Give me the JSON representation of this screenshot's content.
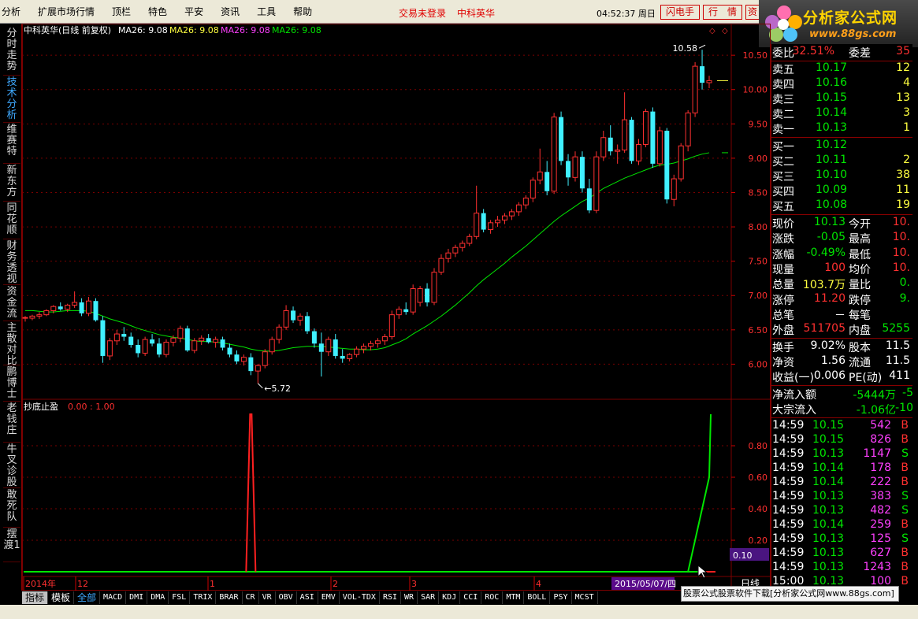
{
  "menu": {
    "items": [
      "分析",
      "扩展市场行情",
      "顶栏",
      "特色",
      "平安",
      "资讯",
      "工具",
      "帮助"
    ],
    "trade_status": "交易未登录",
    "stock_name": "中科英华",
    "clock": "04:52:37 周日",
    "btn_flash": "闪电手",
    "btn_quote": "行　情",
    "btn_info": "资"
  },
  "logo": {
    "title": "分析家公式网",
    "url": "www.88gs.com"
  },
  "left_tabs": [
    "分时走势",
    "技术分析",
    "维赛特",
    "新东方",
    "同花顺",
    "财务透视",
    "资金流",
    "主散对比",
    "鹏博士",
    "老钱庄",
    "牛叉诊股",
    "敢死队",
    "摆渡1"
  ],
  "chart": {
    "header_title": "中科英华(日线 前复权)",
    "ma_items": [
      {
        "label": "MA26: 9.08",
        "color": "#ffffff"
      },
      {
        "label": "MA26: 9.08",
        "color": "#ffff40"
      },
      {
        "label": "MA26: 9.08",
        "color": "#ff40ff"
      },
      {
        "label": "MA26: 9.08",
        "color": "#00e600"
      }
    ],
    "high_label": "10.58",
    "low_label": "5.72",
    "price_ticks": [
      "10.50",
      "10.00",
      "9.50",
      "9.00",
      "8.50",
      "8.00",
      "7.50",
      "7.00",
      "6.50",
      "6.00"
    ],
    "indicator_title": "抄底止盈",
    "indicator_values": "0.00 : 1.00",
    "indicator_ticks": [
      "0.80",
      "0.60",
      "0.40",
      "0.20"
    ],
    "indicator_current": "0.10",
    "date_labels": [
      {
        "text": "2014年",
        "color": "#ff3030",
        "month": 0
      },
      {
        "text": "12",
        "color": "#ff3030",
        "month": 1
      },
      {
        "text": "1",
        "color": "#ff3030",
        "month": 2
      },
      {
        "text": "2",
        "color": "#ff3030",
        "month": 3
      },
      {
        "text": "3",
        "color": "#ff3030",
        "month": 4
      },
      {
        "text": "4",
        "color": "#ff3030",
        "month": 5
      }
    ],
    "date_cursor": "2015/05/07/四",
    "period": "日线",
    "colors": {
      "up": "#ff3030",
      "down": "#40f0ff",
      "ma": "#00e600",
      "grid": "#7a0000",
      "signal_up": "#ff2020",
      "signal_down": "#00e600"
    }
  },
  "chart_data": {
    "type": "candlestick",
    "title": "中科英华(日线 前复权)",
    "ylim": [
      5.5,
      10.8
    ],
    "high": 10.58,
    "low": 5.72,
    "ma26_last": 9.08,
    "candles": [
      [
        6.68,
        6.7,
        6.62,
        6.68
      ],
      [
        6.67,
        6.72,
        6.64,
        6.7
      ],
      [
        6.7,
        6.76,
        6.66,
        6.72
      ],
      [
        6.72,
        6.8,
        6.7,
        6.78
      ],
      [
        6.78,
        6.86,
        6.74,
        6.84
      ],
      [
        6.84,
        6.9,
        6.78,
        6.8
      ],
      [
        6.8,
        6.88,
        6.76,
        6.86
      ],
      [
        6.86,
        7.06,
        6.82,
        6.9
      ],
      [
        6.9,
        6.96,
        6.7,
        6.74
      ],
      [
        6.74,
        6.98,
        6.7,
        6.92
      ],
      [
        6.92,
        6.96,
        6.62,
        6.64
      ],
      [
        6.64,
        6.7,
        6.02,
        6.12
      ],
      [
        6.12,
        6.38,
        6.06,
        6.34
      ],
      [
        6.34,
        6.5,
        6.28,
        6.44
      ],
      [
        6.44,
        6.54,
        6.34,
        6.4
      ],
      [
        6.4,
        6.46,
        6.24,
        6.28
      ],
      [
        6.28,
        6.36,
        6.1,
        6.16
      ],
      [
        6.16,
        6.4,
        6.12,
        6.36
      ],
      [
        6.36,
        6.44,
        6.26,
        6.3
      ],
      [
        6.3,
        6.38,
        6.1,
        6.14
      ],
      [
        6.14,
        6.36,
        6.1,
        6.32
      ],
      [
        6.32,
        6.42,
        6.26,
        6.38
      ],
      [
        6.38,
        6.56,
        6.32,
        6.52
      ],
      [
        6.52,
        6.56,
        6.18,
        6.2
      ],
      [
        6.2,
        6.38,
        6.16,
        6.34
      ],
      [
        6.34,
        6.42,
        6.28,
        6.38
      ],
      [
        6.38,
        6.44,
        6.3,
        6.32
      ],
      [
        6.32,
        6.4,
        6.24,
        6.36
      ],
      [
        6.36,
        6.4,
        6.2,
        6.24
      ],
      [
        6.24,
        6.3,
        6.1,
        6.14
      ],
      [
        6.14,
        6.2,
        6.0,
        6.04
      ],
      [
        6.04,
        6.14,
        5.98,
        6.1
      ],
      [
        6.1,
        6.16,
        5.84,
        5.9
      ],
      [
        5.9,
        6.0,
        5.72,
        5.98
      ],
      [
        5.98,
        6.22,
        5.94,
        6.18
      ],
      [
        6.18,
        6.4,
        6.14,
        6.36
      ],
      [
        6.36,
        6.58,
        6.3,
        6.54
      ],
      [
        6.54,
        6.86,
        6.5,
        6.78
      ],
      [
        6.78,
        6.84,
        6.6,
        6.64
      ],
      [
        6.64,
        6.74,
        6.56,
        6.7
      ],
      [
        6.7,
        6.76,
        6.44,
        6.48
      ],
      [
        6.48,
        6.52,
        6.24,
        6.3
      ],
      [
        6.3,
        6.46,
        5.82,
        6.18
      ],
      [
        6.18,
        6.4,
        6.12,
        6.36
      ],
      [
        6.36,
        6.44,
        6.08,
        6.12
      ],
      [
        6.12,
        6.22,
        6.02,
        6.08
      ],
      [
        6.08,
        6.16,
        6.04,
        6.14
      ],
      [
        6.14,
        6.26,
        6.1,
        6.22
      ],
      [
        6.22,
        6.3,
        6.16,
        6.26
      ],
      [
        6.26,
        6.34,
        6.2,
        6.3
      ],
      [
        6.3,
        6.38,
        6.24,
        6.34
      ],
      [
        6.34,
        6.44,
        6.28,
        6.4
      ],
      [
        6.4,
        6.78,
        6.36,
        6.72
      ],
      [
        6.72,
        6.84,
        6.66,
        6.8
      ],
      [
        6.8,
        6.9,
        6.72,
        6.76
      ],
      [
        6.76,
        7.16,
        6.72,
        7.1
      ],
      [
        6.9,
        7.14,
        6.84,
        7.1
      ],
      [
        7.1,
        7.18,
        6.84,
        6.9
      ],
      [
        6.9,
        7.4,
        6.86,
        7.34
      ],
      [
        7.34,
        7.6,
        7.3,
        7.54
      ],
      [
        7.54,
        7.68,
        7.48,
        7.62
      ],
      [
        7.62,
        7.74,
        7.56,
        7.7
      ],
      [
        7.7,
        7.8,
        7.64,
        7.76
      ],
      [
        7.76,
        7.9,
        7.72,
        7.86
      ],
      [
        7.86,
        8.6,
        7.82,
        8.2
      ],
      [
        8.2,
        8.26,
        7.92,
        7.96
      ],
      [
        7.96,
        8.1,
        7.9,
        8.06
      ],
      [
        8.06,
        8.16,
        8.0,
        8.1
      ],
      [
        8.1,
        8.2,
        8.04,
        8.16
      ],
      [
        8.16,
        8.26,
        8.1,
        8.22
      ],
      [
        8.22,
        8.36,
        8.16,
        8.32
      ],
      [
        8.32,
        8.46,
        8.26,
        8.42
      ],
      [
        8.42,
        8.72,
        8.36,
        8.68
      ],
      [
        8.68,
        9.14,
        8.62,
        8.8
      ],
      [
        8.8,
        8.96,
        8.46,
        8.52
      ],
      [
        8.52,
        9.66,
        8.48,
        9.6
      ],
      [
        9.6,
        9.68,
        8.9,
        8.96
      ],
      [
        8.96,
        9.06,
        8.6,
        8.72
      ],
      [
        8.72,
        9.1,
        8.66,
        9.02
      ],
      [
        9.02,
        9.1,
        8.5,
        8.56
      ],
      [
        8.56,
        8.7,
        8.2,
        8.24
      ],
      [
        8.24,
        9.1,
        8.2,
        9.02
      ],
      [
        9.02,
        9.4,
        8.96,
        9.3
      ],
      [
        9.3,
        9.48,
        9.04,
        9.1
      ],
      [
        9.1,
        9.2,
        8.92,
        9.12
      ],
      [
        9.12,
        9.96,
        9.08,
        9.56
      ],
      [
        9.56,
        9.6,
        8.92,
        8.96
      ],
      [
        8.96,
        9.28,
        8.9,
        9.2
      ],
      [
        9.2,
        9.72,
        9.16,
        9.68
      ],
      [
        9.68,
        9.74,
        8.86,
        8.92
      ],
      [
        8.92,
        9.46,
        8.88,
        9.4
      ],
      [
        9.4,
        9.44,
        8.34,
        8.4
      ],
      [
        8.4,
        8.76,
        8.3,
        8.7
      ],
      [
        8.7,
        9.22,
        8.66,
        9.18
      ],
      [
        9.18,
        9.7,
        9.1,
        9.66
      ],
      [
        9.66,
        10.4,
        9.6,
        10.34
      ],
      [
        10.34,
        10.58,
        10.0,
        10.1
      ],
      [
        10.1,
        10.2,
        10.02,
        10.13
      ]
    ],
    "ma26": [
      6.78,
      6.78,
      6.77,
      6.76,
      6.76,
      6.77,
      6.78,
      6.78,
      6.78,
      6.77,
      6.74,
      6.7,
      6.66,
      6.63,
      6.6,
      6.56,
      6.52,
      6.49,
      6.46,
      6.43,
      6.41,
      6.39,
      6.38,
      6.36,
      6.34,
      6.33,
      6.33,
      6.32,
      6.31,
      6.29,
      6.27,
      6.25,
      6.22,
      6.2,
      6.19,
      6.19,
      6.2,
      6.22,
      6.24,
      6.25,
      6.26,
      6.26,
      6.26,
      6.25,
      6.24,
      6.23,
      6.22,
      6.22,
      6.21,
      6.21,
      6.22,
      6.24,
      6.28,
      6.32,
      6.37,
      6.44,
      6.5,
      6.56,
      6.63,
      6.7,
      6.78,
      6.86,
      6.95,
      7.04,
      7.14,
      7.23,
      7.31,
      7.39,
      7.47,
      7.56,
      7.64,
      7.72,
      7.81,
      7.9,
      7.99,
      8.08,
      8.16,
      8.23,
      8.3,
      8.37,
      8.42,
      8.49,
      8.56,
      8.61,
      8.66,
      8.71,
      8.75,
      8.79,
      8.83,
      8.87,
      8.9,
      8.91,
      8.93,
      8.96,
      8.99,
      9.03,
      9.06,
      9.08
    ],
    "indicator": {
      "name": "抄底止盈",
      "series": [
        {
          "name": "sell_spike",
          "index": 32,
          "value": 1.0
        },
        {
          "name": "buy_rise",
          "from_index": 94,
          "value": 1.0
        }
      ],
      "current": 0.1
    }
  },
  "bottom_tabs": [
    "指标",
    "模板",
    "全部",
    "MACD",
    "DMI",
    "DMA",
    "FSL",
    "TRIX",
    "BRAR",
    "CR",
    "VR",
    "OBV",
    "ASI",
    "EMV",
    "VOL-TDX",
    "RSI",
    "WR",
    "SAR",
    "KDJ",
    "CCI",
    "ROC",
    "MTM",
    "BOLL",
    "PSY",
    "MCST"
  ],
  "footer_text": "股票公式股票软件下载[分析家公式网www.88gs.com]",
  "quote_panel": {
    "weibi": {
      "label": "委比",
      "value": "32.51%",
      "label2": "委差",
      "value2": "35"
    },
    "sells": [
      {
        "label": "卖五",
        "price": "10.17",
        "vol": "12"
      },
      {
        "label": "卖四",
        "price": "10.16",
        "vol": "4"
      },
      {
        "label": "卖三",
        "price": "10.15",
        "vol": "13"
      },
      {
        "label": "卖二",
        "price": "10.14",
        "vol": "3"
      },
      {
        "label": "卖一",
        "price": "10.13",
        "vol": "1"
      }
    ],
    "buys": [
      {
        "label": "买一",
        "price": "10.12",
        "vol": ""
      },
      {
        "label": "买二",
        "price": "10.11",
        "vol": "2"
      },
      {
        "label": "买三",
        "price": "10.10",
        "vol": "38"
      },
      {
        "label": "买四",
        "price": "10.09",
        "vol": "11"
      },
      {
        "label": "买五",
        "price": "10.08",
        "vol": "19"
      }
    ],
    "stats": [
      {
        "l1": "现价",
        "v1": "10.13",
        "c1": "g",
        "l2": "今开",
        "v2": "10.",
        "c2": "r"
      },
      {
        "l1": "涨跌",
        "v1": "-0.05",
        "c1": "g",
        "l2": "最高",
        "v2": "10.",
        "c2": "r"
      },
      {
        "l1": "涨幅",
        "v1": "-0.49%",
        "c1": "g",
        "l2": "最低",
        "v2": "10.",
        "c2": "r"
      },
      {
        "l1": "现量",
        "v1": "100",
        "c1": "r",
        "l2": "均价",
        "v2": "10.",
        "c2": "r"
      },
      {
        "l1": "总量",
        "v1": "103.7万",
        "c1": "y",
        "l2": "量比",
        "v2": "0.",
        "c2": "g"
      },
      {
        "l1": "涨停",
        "v1": "11.20",
        "c1": "r",
        "l2": "跌停",
        "v2": "9.",
        "c2": "g"
      },
      {
        "l1": "总笔",
        "v1": "－",
        "c1": "w",
        "l2": "每笔",
        "v2": "",
        "c2": "w"
      },
      {
        "l1": "外盘",
        "v1": "511705",
        "c1": "r",
        "l2": "内盘",
        "v2": "5255",
        "c2": "g"
      }
    ],
    "fin": [
      {
        "l1": "换手",
        "v1": "9.02%",
        "c1": "w",
        "l2": "股本",
        "v2": "11.5",
        "c2": "w"
      },
      {
        "l1": "净资",
        "v1": "1.56",
        "c1": "w",
        "l2": "流通",
        "v2": "11.5",
        "c2": "w"
      },
      {
        "l1": "收益(一)",
        "v1": "0.006",
        "c1": "w",
        "l2": "PE(动)",
        "v2": "411",
        "c2": "w"
      }
    ],
    "flows": [
      {
        "label": "净流入额",
        "value": "-5444万",
        "extra": "-5"
      },
      {
        "label": "大宗流入",
        "value": "-1.06亿",
        "extra": "-10"
      }
    ],
    "ticks": [
      {
        "time": "14:59",
        "price": "10.15",
        "vol": "542",
        "bs": "B"
      },
      {
        "time": "14:59",
        "price": "10.15",
        "vol": "826",
        "bs": "B"
      },
      {
        "time": "14:59",
        "price": "10.13",
        "vol": "1147",
        "bs": "S"
      },
      {
        "time": "14:59",
        "price": "10.14",
        "vol": "178",
        "bs": "B"
      },
      {
        "time": "14:59",
        "price": "10.14",
        "vol": "222",
        "bs": "B"
      },
      {
        "time": "14:59",
        "price": "10.13",
        "vol": "383",
        "bs": "S"
      },
      {
        "time": "14:59",
        "price": "10.13",
        "vol": "482",
        "bs": "S"
      },
      {
        "time": "14:59",
        "price": "10.14",
        "vol": "259",
        "bs": "B"
      },
      {
        "time": "14:59",
        "price": "10.13",
        "vol": "125",
        "bs": "S"
      },
      {
        "time": "14:59",
        "price": "10.13",
        "vol": "627",
        "bs": "B"
      },
      {
        "time": "14:59",
        "price": "10.13",
        "vol": "1243",
        "bs": "B"
      },
      {
        "time": "15:00",
        "price": "10.13",
        "vol": "100",
        "bs": "B"
      }
    ]
  }
}
